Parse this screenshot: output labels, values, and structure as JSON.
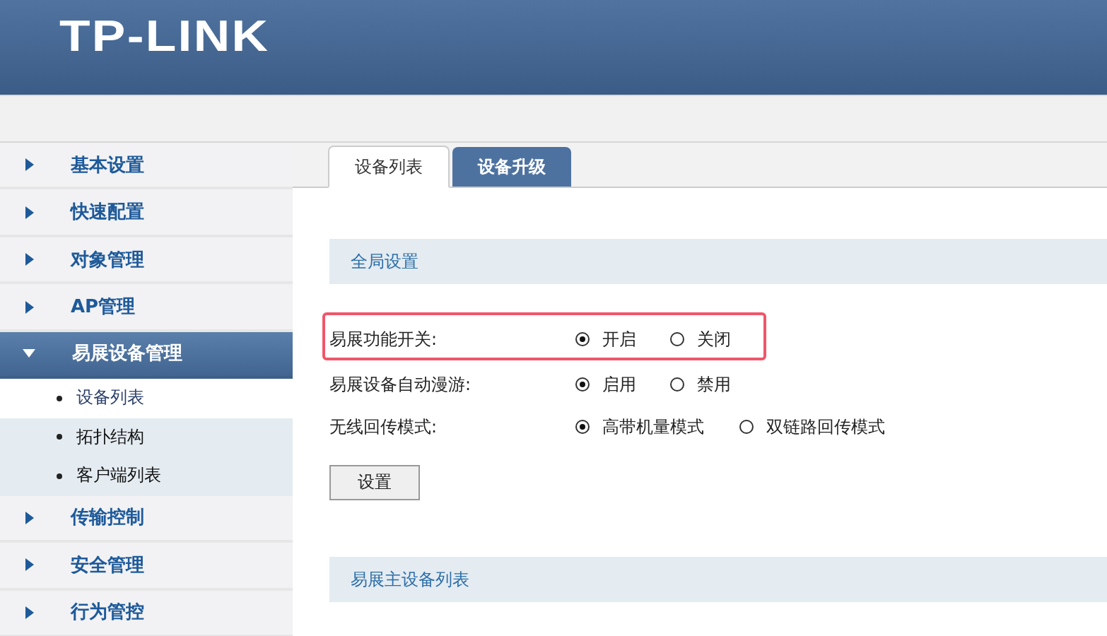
{
  "header": {
    "logo": "TP-LINK"
  },
  "sidebar": {
    "items": [
      {
        "label": "基本设置",
        "expanded": false
      },
      {
        "label": "快速配置",
        "expanded": false
      },
      {
        "label": "对象管理",
        "expanded": false
      },
      {
        "label": "AP管理",
        "expanded": false
      },
      {
        "label": "易展设备管理",
        "expanded": true,
        "children": [
          {
            "label": "设备列表",
            "selected": true
          },
          {
            "label": "拓扑结构",
            "selected": false
          },
          {
            "label": "客户端列表",
            "selected": false
          }
        ]
      },
      {
        "label": "传输控制",
        "expanded": false
      },
      {
        "label": "安全管理",
        "expanded": false
      },
      {
        "label": "行为管控",
        "expanded": false
      }
    ]
  },
  "tabs": [
    {
      "label": "设备列表",
      "selected": true
    },
    {
      "label": "设备升级",
      "selected": false
    }
  ],
  "global_settings": {
    "title": "全局设置",
    "rows": [
      {
        "label": "易展功能开关:",
        "highlighted": true,
        "options": [
          {
            "label": "开启",
            "selected": true
          },
          {
            "label": "关闭",
            "selected": false
          }
        ]
      },
      {
        "label": "易展设备自动漫游:",
        "highlighted": false,
        "options": [
          {
            "label": "启用",
            "selected": true
          },
          {
            "label": "禁用",
            "selected": false
          }
        ]
      },
      {
        "label": "无线回传模式:",
        "highlighted": false,
        "options": [
          {
            "label": "高带机量模式",
            "selected": true
          },
          {
            "label": "双链路回传模式",
            "selected": false
          }
        ]
      }
    ],
    "button": "设置"
  },
  "master_list": {
    "title": "易展主设备列表"
  }
}
